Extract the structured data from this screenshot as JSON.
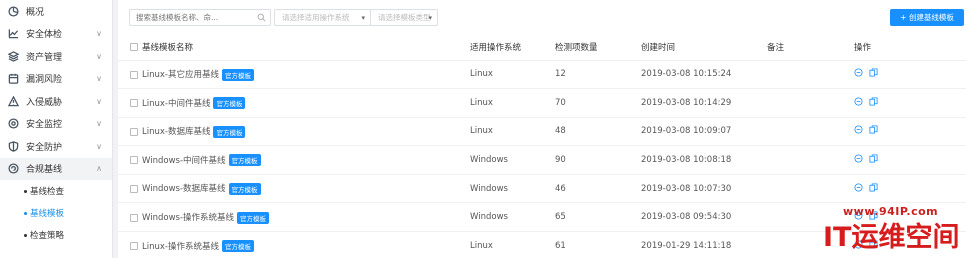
{
  "sidebar": {
    "items": [
      {
        "label": "概况",
        "icon": "overview-icon",
        "has_children": false
      },
      {
        "label": "安全体检",
        "icon": "checkup-icon",
        "has_children": true
      },
      {
        "label": "资产管理",
        "icon": "assets-icon",
        "has_children": true
      },
      {
        "label": "漏洞风险",
        "icon": "vulnerability-icon",
        "has_children": true
      },
      {
        "label": "入侵威胁",
        "icon": "intrusion-icon",
        "has_children": true
      },
      {
        "label": "安全监控",
        "icon": "monitor-icon",
        "has_children": true
      },
      {
        "label": "安全防护",
        "icon": "shield-icon",
        "has_children": true
      },
      {
        "label": "合规基线",
        "icon": "baseline-icon",
        "has_children": true,
        "expanded": true
      }
    ],
    "subitems": [
      {
        "label": "基线检查",
        "active": false
      },
      {
        "label": "基线模板",
        "active": true
      },
      {
        "label": "检查策略",
        "active": false
      }
    ]
  },
  "toolbar": {
    "search_placeholder": "搜索基线模板名称、命...",
    "os_placeholder": "请选择适用操作系统",
    "type_placeholder": "请选择模板类型",
    "create_label": "+ 创建基线模板"
  },
  "table": {
    "headers": [
      "基线模板名称",
      "适用操作系统",
      "检测项数量",
      "创建时间",
      "备注",
      "操作"
    ],
    "tag_label": "官方模板",
    "rows": [
      {
        "name": "Linux-其它应用基线",
        "os": "Linux",
        "count": "12",
        "time": "2019-03-08 10:15:24",
        "note": ""
      },
      {
        "name": "Linux-中间件基线",
        "os": "Linux",
        "count": "70",
        "time": "2019-03-08 10:14:29",
        "note": ""
      },
      {
        "name": "Linux-数据库基线",
        "os": "Linux",
        "count": "48",
        "time": "2019-03-08 10:09:07",
        "note": ""
      },
      {
        "name": "Windows-中间件基线",
        "os": "Windows",
        "count": "90",
        "time": "2019-03-08 10:08:18",
        "note": ""
      },
      {
        "name": "Windows-数据库基线",
        "os": "Windows",
        "count": "46",
        "time": "2019-03-08 10:07:30",
        "note": ""
      },
      {
        "name": "Windows-操作系统基线",
        "os": "Windows",
        "count": "65",
        "time": "2019-03-08 09:54:30",
        "note": ""
      },
      {
        "name": "Linux-操作系统基线",
        "os": "Linux",
        "count": "61",
        "time": "2019-01-29 14:11:18",
        "note": ""
      }
    ]
  },
  "watermark": {
    "url": "www.94IP.com",
    "name": "IT运维空间"
  },
  "colors": {
    "accent": "#1890ff",
    "watermark": "#d61c1c"
  }
}
